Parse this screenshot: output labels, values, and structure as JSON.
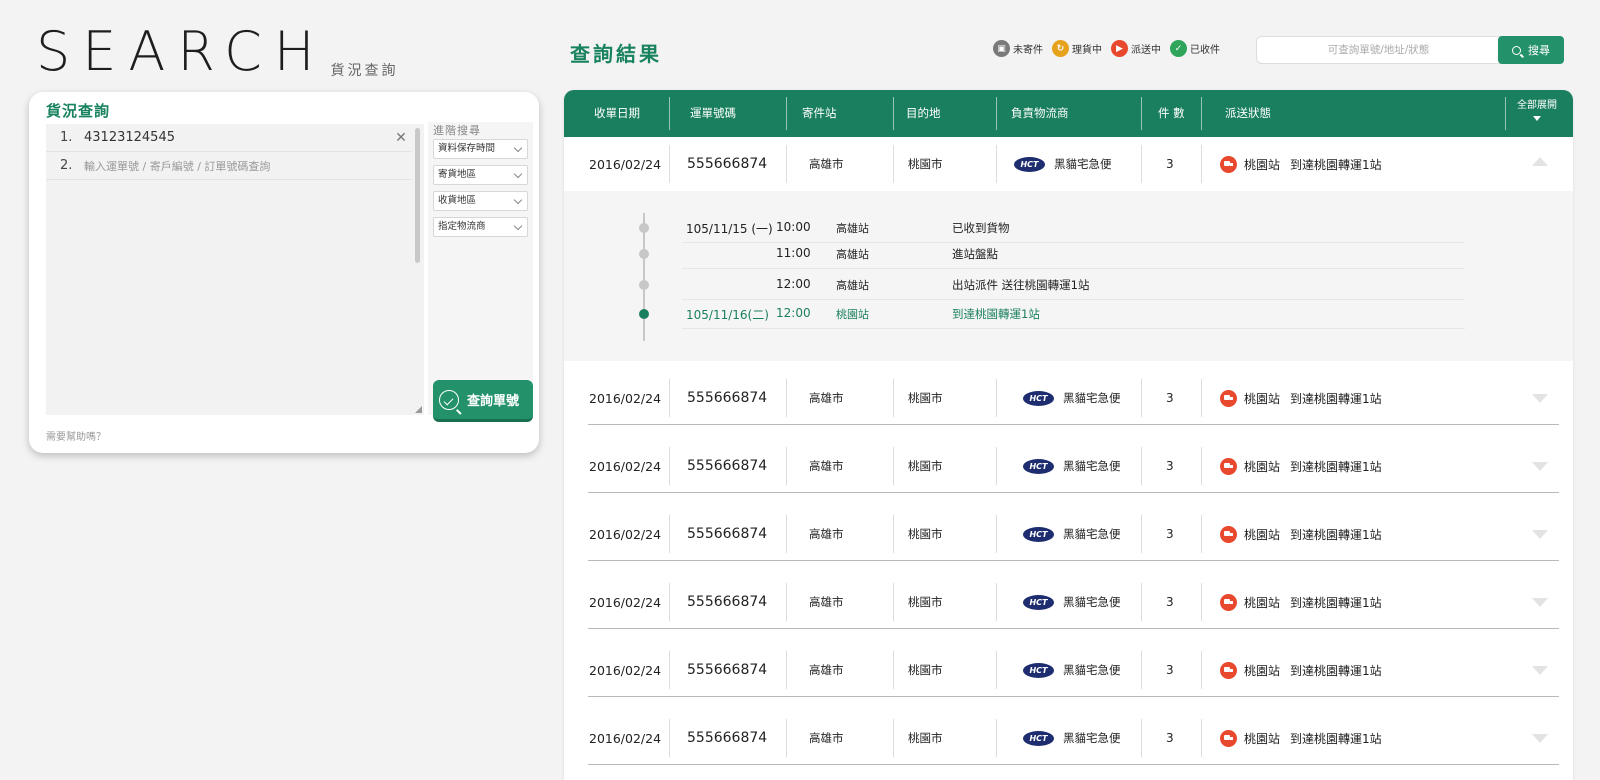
{
  "brand": {
    "title": "SEARCH",
    "subtitle": "貨況查詢"
  },
  "query_card": {
    "title": "貨況查詢",
    "lines": [
      {
        "num": "1.",
        "value": "43123124545"
      },
      {
        "num": "2.",
        "placeholder": "輸入運單號 / 寄戶編號 / 訂單號碼查詢"
      }
    ],
    "advanced_title": "進階搜尋",
    "filters": [
      "資料保存時間",
      "寄貨地區",
      "收貨地區",
      "指定物流商"
    ],
    "submit_label": "查詢單號",
    "help_text": "需要幫助嗎？"
  },
  "results": {
    "title": "查詢結果",
    "legend": [
      {
        "label": "未寄件",
        "color": "#7a7a7a",
        "icon": "box-icon"
      },
      {
        "label": "理貨中",
        "color": "#e7a21c",
        "icon": "sort-icon"
      },
      {
        "label": "派送中",
        "color": "#e8482d",
        "icon": "truck-icon"
      },
      {
        "label": "已收件",
        "color": "#2fa55b",
        "icon": "check-icon"
      }
    ],
    "search": {
      "placeholder": "可查詢單號/地址/狀態",
      "button": "搜尋"
    },
    "headers": {
      "date": "收單日期",
      "number": "運單號碼",
      "from": "寄件站",
      "to": "目的地",
      "logistics": "負責物流商",
      "qty": "件 數",
      "status": "派送狀態",
      "expand_all": "全部展開"
    },
    "rows": [
      {
        "date": "2016/02/24",
        "number": "555666874",
        "from": "高雄市",
        "to": "桃園市",
        "logo": "HCT",
        "carrier": "黑貓宅急便",
        "qty": "3",
        "station": "桃園站",
        "status": "到達桃園轉運1站"
      },
      {
        "date": "2016/02/24",
        "number": "555666874",
        "from": "高雄市",
        "to": "桃園市",
        "logo": "HCT",
        "carrier": "黑貓宅急便",
        "qty": "3",
        "station": "桃園站",
        "status": "到達桃園轉運1站"
      },
      {
        "date": "2016/02/24",
        "number": "555666874",
        "from": "高雄市",
        "to": "桃園市",
        "logo": "HCT",
        "carrier": "黑貓宅急便",
        "qty": "3",
        "station": "桃園站",
        "status": "到達桃園轉運1站"
      },
      {
        "date": "2016/02/24",
        "number": "555666874",
        "from": "高雄市",
        "to": "桃園市",
        "logo": "HCT",
        "carrier": "黑貓宅急便",
        "qty": "3",
        "station": "桃園站",
        "status": "到達桃園轉運1站"
      },
      {
        "date": "2016/02/24",
        "number": "555666874",
        "from": "高雄市",
        "to": "桃園市",
        "logo": "HCT",
        "carrier": "黑貓宅急便",
        "qty": "3",
        "station": "桃園站",
        "status": "到達桃園轉運1站"
      },
      {
        "date": "2016/02/24",
        "number": "555666874",
        "from": "高雄市",
        "to": "桃園市",
        "logo": "HCT",
        "carrier": "黑貓宅急便",
        "qty": "3",
        "station": "桃園站",
        "status": "到達桃園轉運1站"
      },
      {
        "date": "2016/02/24",
        "number": "555666874",
        "from": "高雄市",
        "to": "桃園市",
        "logo": "HCT",
        "carrier": "黑貓宅急便",
        "qty": "3",
        "station": "桃園站",
        "status": "到達桃園轉運1站"
      }
    ],
    "timeline": [
      {
        "date": "105/11/15 (一)",
        "time": "10:00",
        "station": "高雄站",
        "message": "已收到貨物",
        "current": false
      },
      {
        "date": "",
        "time": "11:00",
        "station": "高雄站",
        "message": "進站盤點",
        "current": false
      },
      {
        "date": "",
        "time": "12:00",
        "station": "高雄站",
        "message": "出站派件 送往桃園轉運1站",
        "current": false
      },
      {
        "date": "105/11/16(二)",
        "time": "12:00",
        "station": "桃園站",
        "message": "到達桃園轉運1站",
        "current": true
      }
    ]
  },
  "colors": {
    "accent": "#1a7f5e",
    "delivering": "#e8482d",
    "carrier_logo": "#1e2d6f"
  }
}
